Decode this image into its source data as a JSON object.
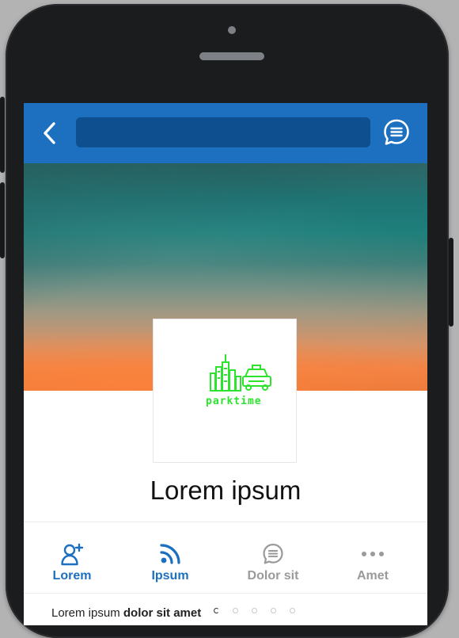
{
  "header": {
    "search_value": "",
    "search_placeholder": ""
  },
  "logo": {
    "text": "parktime"
  },
  "profile": {
    "title": "Lorem ipsum"
  },
  "tabs": [
    {
      "label": "Lorem",
      "icon": "add-user-icon",
      "color": "#1d6fbf"
    },
    {
      "label": "Ipsum",
      "icon": "rss-feed-icon",
      "color": "#1d6fbf"
    },
    {
      "label": "Dolor sit",
      "icon": "chat-bubble-icon",
      "color": "#9a9a9a"
    },
    {
      "label": "Amet",
      "icon": "more-dots-icon",
      "color": "#9a9a9a"
    }
  ],
  "footer": {
    "text_plain": "Lorem ipsum ",
    "text_bold": "dolor sit amet"
  },
  "colors": {
    "appbar": "#1d6fbf",
    "searchbar": "#0e4f8f",
    "logo_green": "#2de32d"
  }
}
